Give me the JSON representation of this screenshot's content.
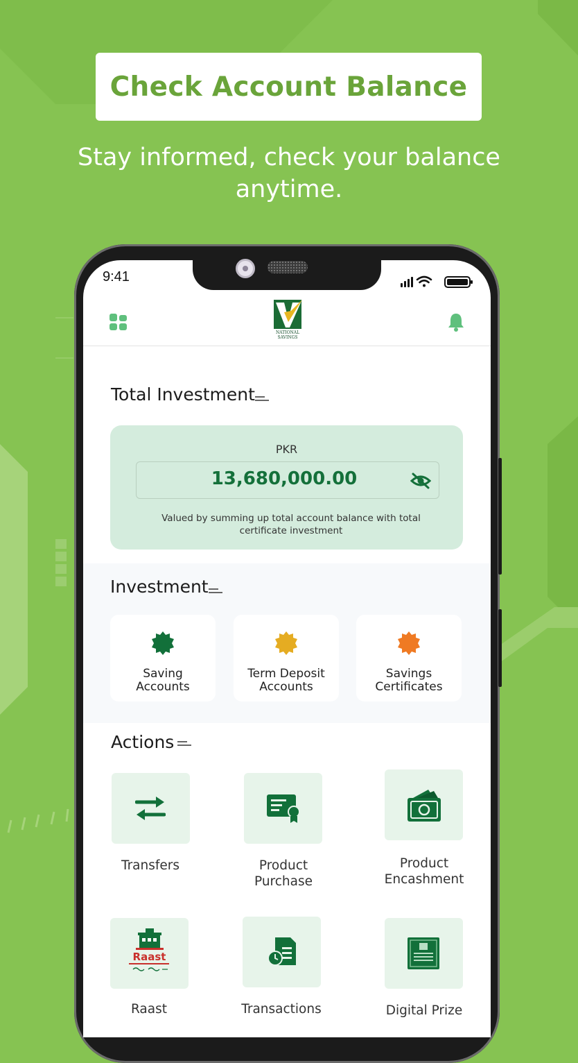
{
  "promo": {
    "headline": "Check Account Balance",
    "subtitle": "Stay informed, check your balance anytime."
  },
  "status_bar": {
    "time": "9:41"
  },
  "app": {
    "logo_line1": "NATIONAL",
    "logo_line2": "SAVINGS"
  },
  "total_investment": {
    "title": "Total Investment",
    "currency": "PKR",
    "amount": "13,680,000.00",
    "note": "Valued by summing up total account balance with total certificate investment"
  },
  "investment": {
    "title": "Investment",
    "items": [
      {
        "label_line1": "Saving",
        "label_line2": "Accounts",
        "color": "#12703a"
      },
      {
        "label_line1": "Term Deposit",
        "label_line2": "Accounts",
        "color": "#e5ac22"
      },
      {
        "label_line1": "Savings",
        "label_line2": "Certificates",
        "color": "#ef7a23"
      }
    ]
  },
  "actions": {
    "title": "Actions",
    "items": [
      {
        "line1": "Transfers",
        "line2": ""
      },
      {
        "line1": "Product",
        "line2": "Purchase"
      },
      {
        "line1": "Product",
        "line2": "Encashment"
      },
      {
        "line1": "Raast",
        "line2": ""
      },
      {
        "line1": "Transactions",
        "line2": ""
      },
      {
        "line1": "Digital Prize",
        "line2": ""
      }
    ],
    "raast_logo_text": "Raast"
  },
  "colors": {
    "background": "#86c352",
    "brand_green": "#12703a",
    "headline_green": "#6aa43a"
  }
}
